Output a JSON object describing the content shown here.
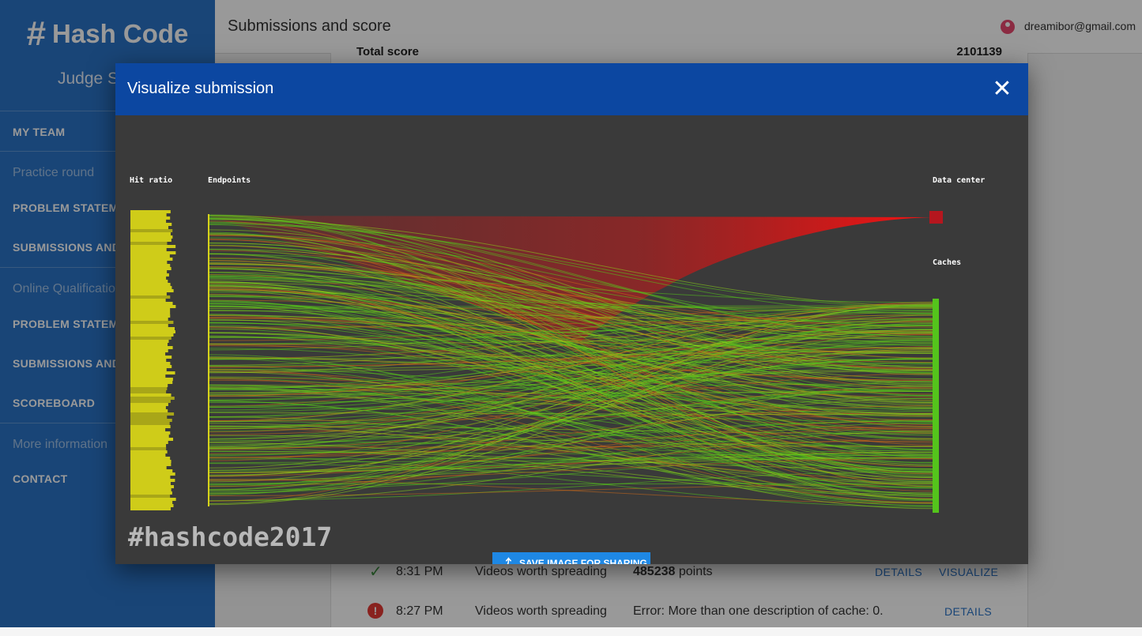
{
  "sidebar": {
    "logo_hash": "#",
    "logo_text": "Hash Code",
    "subtitle": "Judge System",
    "my_team": "MY TEAM",
    "practice_label": "Practice round",
    "practice_problem": "PROBLEM STATEMENT",
    "practice_submissions": "SUBMISSIONS AND SCORE",
    "online_label": "Online Qualification Round",
    "online_problem": "PROBLEM STATEMENT",
    "online_submissions": "SUBMISSIONS AND SCORE",
    "scoreboard": "SCOREBOARD",
    "more_label": "More information",
    "contact": "CONTACT"
  },
  "header": {
    "title": "Submissions and score",
    "user_email": "dreamibor@gmail.com"
  },
  "score": {
    "label": "Total score",
    "value": "2101139"
  },
  "submissions": [
    {
      "time": "8:31 PM",
      "dataset": "Videos worth spreading",
      "result_bold": "485238",
      "result_rest": " points",
      "status": "ok",
      "details": "DETAILS",
      "visualize": "VISUALIZE"
    },
    {
      "time": "8:27 PM",
      "dataset": "Videos worth spreading",
      "result_text": "Error: More than one description of cache: 0.",
      "status": "error",
      "details": "DETAILS"
    }
  ],
  "dialog": {
    "title": "Visualize submission",
    "close_icon": "close-icon",
    "share_icon": "share-icon",
    "share_label": "SAVE IMAGE FOR SHARING",
    "labels": {
      "hit_ratio": "Hit ratio",
      "endpoints": "Endpoints",
      "data_center": "Data center",
      "caches": "Caches"
    },
    "watermark": "#hashcode2017",
    "colors": {
      "background": "#3a3a3a",
      "hit_bar": "#c9c716",
      "datacenter": "#e10f0f",
      "cache": "#54c41c",
      "header": "#0c47a1"
    }
  }
}
